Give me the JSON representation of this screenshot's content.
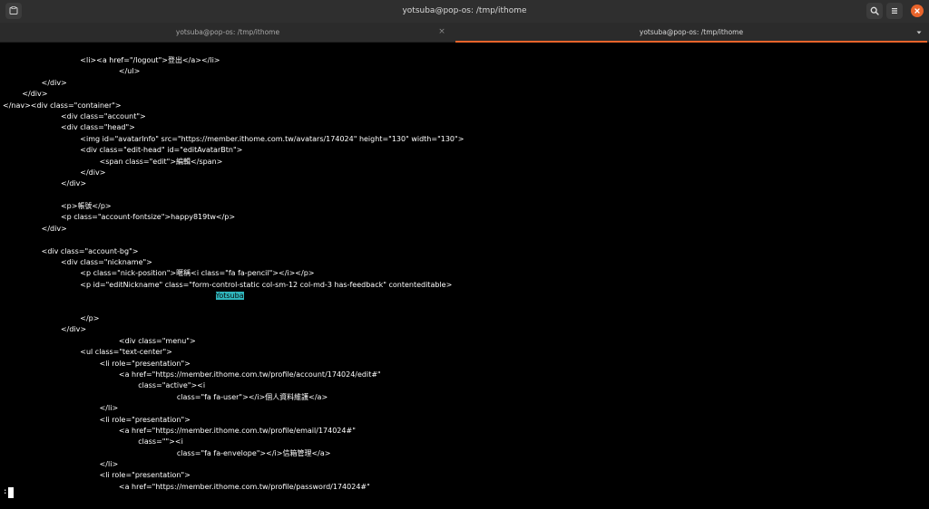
{
  "window": {
    "title": "yotsuba@pop-os: /tmp/ithome",
    "icons": {
      "new_tab": "terminal-tab-icon",
      "search": "search-icon",
      "menu": "hamburger-menu-icon",
      "close": "close-icon"
    },
    "accent_color": "#e9642b"
  },
  "tabs": [
    {
      "label": "yotsuba@pop-os: /tmp/ithome",
      "active": false,
      "close": "×"
    },
    {
      "label": "yotsuba@pop-os: /tmp/ithome",
      "active": true
    }
  ],
  "terminal": {
    "lines": [
      {
        "indent": 16,
        "text": "<li><a href=\"/logout\">登出</a></li>"
      },
      {
        "indent": 24,
        "text": "</ul>"
      },
      {
        "indent": 8,
        "text": "</div>"
      },
      {
        "indent": 4,
        "text": "</div>"
      },
      {
        "indent": 0,
        "text": "</nav><div class=\"container\">"
      },
      {
        "indent": 12,
        "text": "<div class=\"account\">"
      },
      {
        "indent": 12,
        "text": "<div class=\"head\">"
      },
      {
        "indent": 16,
        "text": "<img id=\"avatarInfo\" src=\"https://member.ithome.com.tw/avatars/174024\" height=\"130\" width=\"130\">"
      },
      {
        "indent": 16,
        "text": "<div class=\"edit-head\" id=\"editAvatarBtn\">"
      },
      {
        "indent": 20,
        "text": "<span class=\"edit\">編輯</span>"
      },
      {
        "indent": 16,
        "text": "</div>"
      },
      {
        "indent": 12,
        "text": "</div>"
      },
      {
        "indent": 0,
        "text": ""
      },
      {
        "indent": 12,
        "text": "<p>帳號</p>"
      },
      {
        "indent": 12,
        "text": "<p class=\"account-fontsize\">happy819tw</p>"
      },
      {
        "indent": 8,
        "text": "</div>"
      },
      {
        "indent": 0,
        "text": ""
      },
      {
        "indent": 8,
        "text": "<div class=\"account-bg\">"
      },
      {
        "indent": 12,
        "text": "<div class=\"nickname\">"
      },
      {
        "indent": 16,
        "text": "<p class=\"nick-position\">暱稱<i class=\"fa fa-pencil\"></i></p>"
      },
      {
        "indent": 16,
        "text": "<p id=\"editNickname\" class=\"form-control-static col-sm-12 col-md-3 has-feedback\" contenteditable>"
      },
      {
        "indent": 44,
        "text": "Yotsuba",
        "highlight": true
      },
      {
        "indent": 0,
        "text": ""
      },
      {
        "indent": 16,
        "text": "</p>"
      },
      {
        "indent": 12,
        "text": "</div>"
      },
      {
        "indent": 24,
        "text": "<div class=\"menu\">"
      },
      {
        "indent": 16,
        "text": "<ul class=\"text-center\">"
      },
      {
        "indent": 20,
        "text": "<li role=\"presentation\">"
      },
      {
        "indent": 24,
        "text": "<a href=\"https://member.ithome.com.tw/profile/account/174024/edit#\""
      },
      {
        "indent": 28,
        "text": "class=\"active\"><i"
      },
      {
        "indent": 36,
        "text": "class=\"fa fa-user\"></i>個人資料維護</a>"
      },
      {
        "indent": 20,
        "text": "</li>"
      },
      {
        "indent": 20,
        "text": "<li role=\"presentation\">"
      },
      {
        "indent": 24,
        "text": "<a href=\"https://member.ithome.com.tw/profile/email/174024#\""
      },
      {
        "indent": 28,
        "text": "class=\"\"><i"
      },
      {
        "indent": 36,
        "text": "class=\"fa fa-envelope\"></i>信箱管理</a>"
      },
      {
        "indent": 20,
        "text": "</li>"
      },
      {
        "indent": 20,
        "text": "<li role=\"presentation\">"
      },
      {
        "indent": 24,
        "text": "<a href=\"https://member.ithome.com.tw/profile/password/174024#\""
      }
    ],
    "prompt": ":",
    "highlight_color": "#2fb6bd"
  }
}
